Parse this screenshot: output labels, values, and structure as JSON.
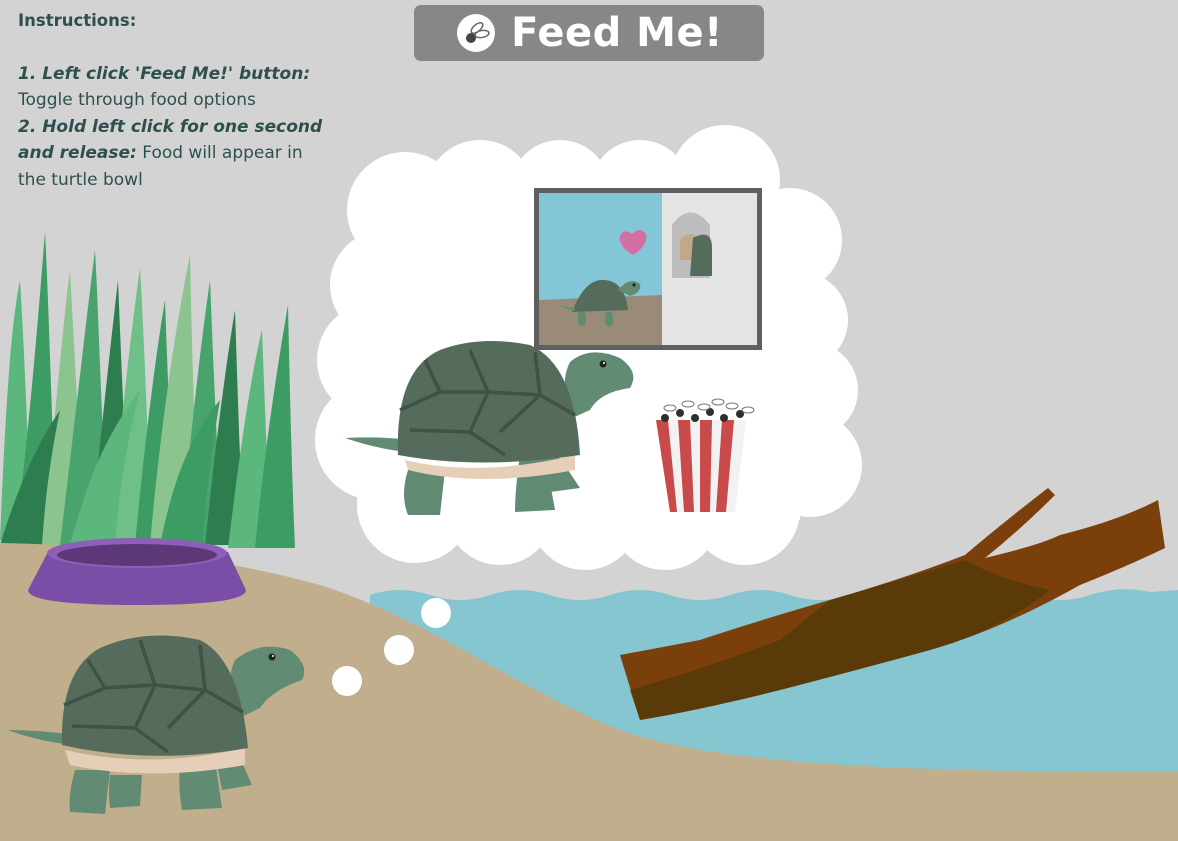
{
  "instructions": {
    "heading": "Instructions:",
    "step1_label": "1. Left click 'Feed Me!' button:",
    "step1_text": "Toggle through food options",
    "step2_label": "2. Hold left click for one second and release:",
    "step2_text": "Food will appear in the turtle bowl"
  },
  "feed_button": {
    "label": "Feed Me!",
    "icon": "fly-icon"
  },
  "thought": {
    "current_food": "popcorn-flies"
  },
  "colors": {
    "background": "#d3d3d3",
    "sand": "#c0ae8c",
    "water": "#85c6d1",
    "shell": "#556b5b",
    "skin": "#628b73",
    "grass": "#3c9c63",
    "bowl": "#7a4ea6",
    "log": "#7b3f0b",
    "button": "#878787",
    "text": "#2f4f4f"
  }
}
